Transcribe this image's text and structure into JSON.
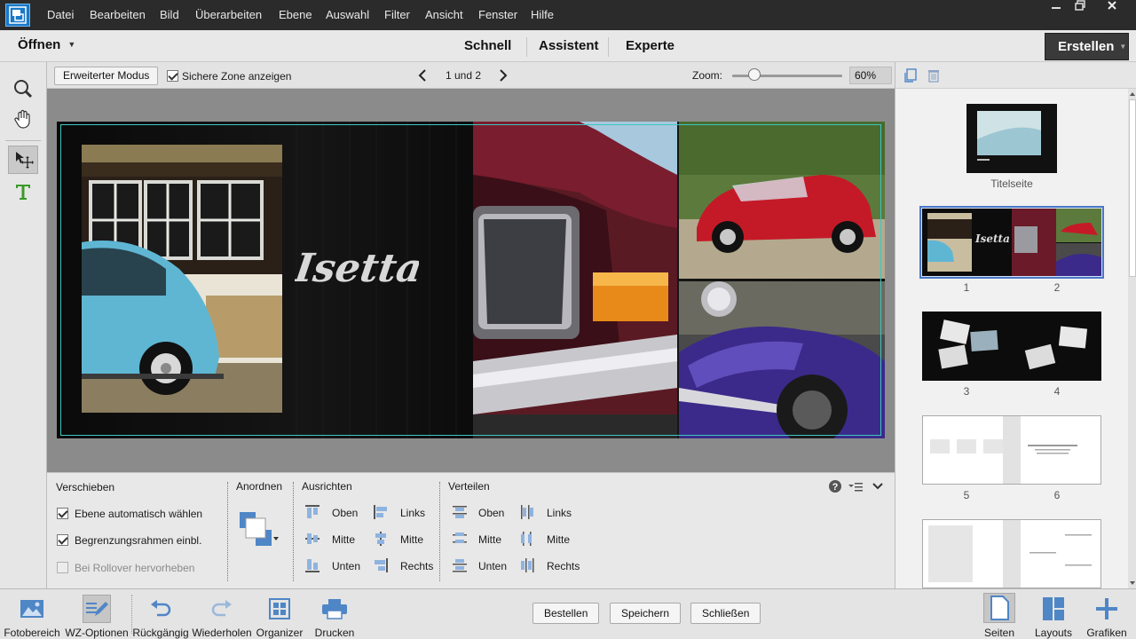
{
  "menubar": {
    "items": [
      "Datei",
      "Bearbeiten",
      "Bild",
      "Überarbeiten",
      "Ebene",
      "Auswahl",
      "Filter",
      "Ansicht",
      "Fenster",
      "Hilfe"
    ]
  },
  "modebar": {
    "open_label": "Öffnen",
    "tabs": [
      "Schnell",
      "Assistent",
      "Experte"
    ],
    "create_label": "Erstellen"
  },
  "options_bar": {
    "extended_mode_label": "Erweiterter Modus",
    "safe_zone_label": "Sichere Zone anzeigen",
    "safe_zone_checked": true,
    "page_indicator": "1 und 2",
    "zoom_label": "Zoom:",
    "zoom_value": "60%",
    "zoom_fraction": 0.2
  },
  "canvas": {
    "title_text": "Isetta"
  },
  "tool_options": {
    "move": {
      "title": "Verschieben",
      "options": [
        {
          "label": "Ebene automatisch wählen",
          "checked": true,
          "enabled": true
        },
        {
          "label": "Begrenzungsrahmen einbl.",
          "checked": true,
          "enabled": true
        },
        {
          "label": "Bei Rollover hervorheben",
          "checked": false,
          "enabled": false
        }
      ]
    },
    "arrange_title": "Anordnen",
    "align": {
      "title": "Ausrichten",
      "col1": [
        "Oben",
        "Mitte",
        "Unten"
      ],
      "col2": [
        "Links",
        "Mitte",
        "Rechts"
      ]
    },
    "distribute": {
      "title": "Verteilen",
      "col1": [
        "Oben",
        "Mitte",
        "Unten"
      ],
      "col2": [
        "Links",
        "Mitte",
        "Rechts"
      ]
    }
  },
  "pages_panel": {
    "thumbs": [
      {
        "labels": [
          "Titelseite"
        ]
      },
      {
        "labels": [
          "1",
          "2"
        ]
      },
      {
        "labels": [
          "3",
          "4"
        ]
      },
      {
        "labels": [
          "5",
          "6"
        ]
      },
      {
        "labels": []
      }
    ]
  },
  "bottombar": {
    "left_items": [
      "Fotobereich",
      "WZ-Optionen",
      "Rückgängig",
      "Wiederholen",
      "Organizer",
      "Drucken"
    ],
    "buttons": [
      "Bestellen",
      "Speichern",
      "Schließen"
    ],
    "right_items": [
      "Seiten",
      "Layouts",
      "Grafiken"
    ]
  },
  "colors": {
    "accent": "#1a78c8",
    "safe_zone": "#3cc6c0",
    "selection": "#4a78c8"
  }
}
